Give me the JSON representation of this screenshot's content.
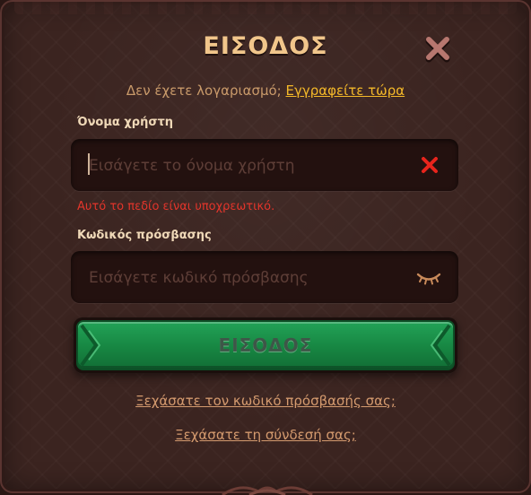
{
  "dialog": {
    "title": "ΕΙΣΟΔΟΣ",
    "signup_prompt": "Δεν έχετε λογαριασμό;",
    "signup_link": "Εγγραφείτε τώρα"
  },
  "username": {
    "label": "Όνομα χρήστη",
    "placeholder": "Εισάγετε το όνομα χρήστη",
    "value": "",
    "error": "Αυτό το πεδίο είναι υποχρεωτικό."
  },
  "password": {
    "label": "Κωδικός πρόσβασης",
    "placeholder": "Εισάγετε κωδικό πρόσβασης",
    "value": ""
  },
  "submit": {
    "label": "ΕΙΣΟΔΟΣ"
  },
  "links": {
    "forgot_password": "Ξεχάσατε τον κωδικό πρόσβασής σας;",
    "forgot_login": "Ξεχάσατε τη σύνδεσή σας;"
  },
  "colors": {
    "title": "#f1c68b",
    "accent_link": "#f3b829",
    "error": "#e3352b",
    "button_green": "#178642",
    "background": "#3b2420"
  },
  "icons": {
    "close": "close-icon",
    "clear": "clear-input-icon",
    "password_visibility": "eye-closed-icon"
  }
}
